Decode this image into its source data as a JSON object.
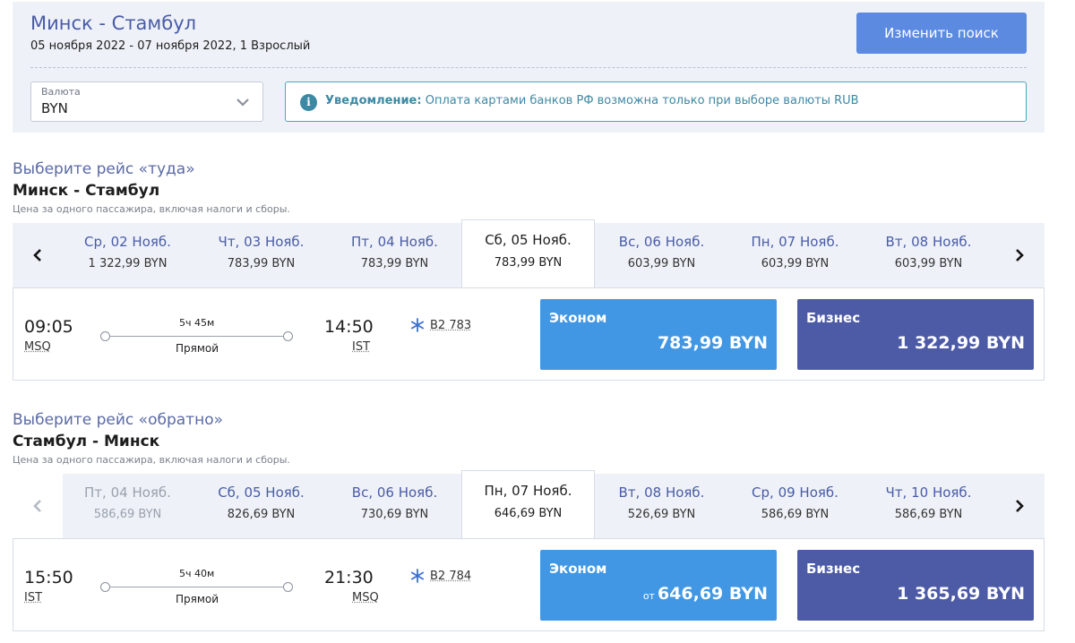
{
  "header": {
    "title": "Минск - Стамбул",
    "subtitle": "05 ноября 2022 - 07 ноября 2022, 1 Взрослый",
    "change_button": "Изменить поиск",
    "currency_label": "Валюта",
    "currency_value": "BYN",
    "notice_bold": "Уведомление:",
    "notice_text": "Оплата картами банков РФ возможна только при выборе валюты RUB"
  },
  "outbound": {
    "heading": "Выберите рейс «туда»",
    "route": "Минск - Стамбул",
    "note": "Цена за одного пассажира, включая налоги и сборы.",
    "dates": [
      {
        "name": "Ср, 02 Нояб.",
        "price": "1 322,99 BYN"
      },
      {
        "name": "Чт, 03 Нояб.",
        "price": "783,99 BYN"
      },
      {
        "name": "Пт, 04 Нояб.",
        "price": "783,99 BYN"
      },
      {
        "name": "Сб, 05 Нояб.",
        "price": "783,99 BYN"
      },
      {
        "name": "Вс, 06 Нояб.",
        "price": "603,99 BYN"
      },
      {
        "name": "Пн, 07 Нояб.",
        "price": "603,99 BYN"
      },
      {
        "name": "Вт, 08 Нояб.",
        "price": "603,99 BYN"
      }
    ],
    "flight": {
      "dep_time": "09:05",
      "dep_code": "MSQ",
      "duration": "5ч 45м",
      "stops": "Прямой",
      "arr_time": "14:50",
      "arr_code": "IST",
      "flight_no": "B2 783",
      "econ_label": "Эконом",
      "econ_from": "",
      "econ_price": "783,99 BYN",
      "biz_label": "Бизнес",
      "biz_price": "1 322,99 BYN"
    }
  },
  "inbound": {
    "heading": "Выберите рейс «обратно»",
    "route": "Стамбул - Минск",
    "note": "Цена за одного пассажира, включая налоги и сборы.",
    "dates": [
      {
        "name": "Пт, 04 Нояб.",
        "price": "586,69 BYN"
      },
      {
        "name": "Сб, 05 Нояб.",
        "price": "826,69 BYN"
      },
      {
        "name": "Вс, 06 Нояб.",
        "price": "730,69 BYN"
      },
      {
        "name": "Пн, 07 Нояб.",
        "price": "646,69 BYN"
      },
      {
        "name": "Вт, 08 Нояб.",
        "price": "526,69 BYN"
      },
      {
        "name": "Ср, 09 Нояб.",
        "price": "586,69 BYN"
      },
      {
        "name": "Чт, 10 Нояб.",
        "price": "586,69 BYN"
      }
    ],
    "flight": {
      "dep_time": "15:50",
      "dep_code": "IST",
      "duration": "5ч 40м",
      "stops": "Прямой",
      "arr_time": "21:30",
      "arr_code": "MSQ",
      "flight_no": "B2 784",
      "econ_label": "Эконом",
      "econ_from": "от",
      "econ_price": "646,69 BYN",
      "biz_label": "Бизнес",
      "biz_price": "1 365,69 BYN"
    }
  },
  "colors": {
    "accent": "#4a5ba6",
    "economy": "#4197e4",
    "business": "#4d5ba6",
    "notice": "#3d88a3"
  }
}
